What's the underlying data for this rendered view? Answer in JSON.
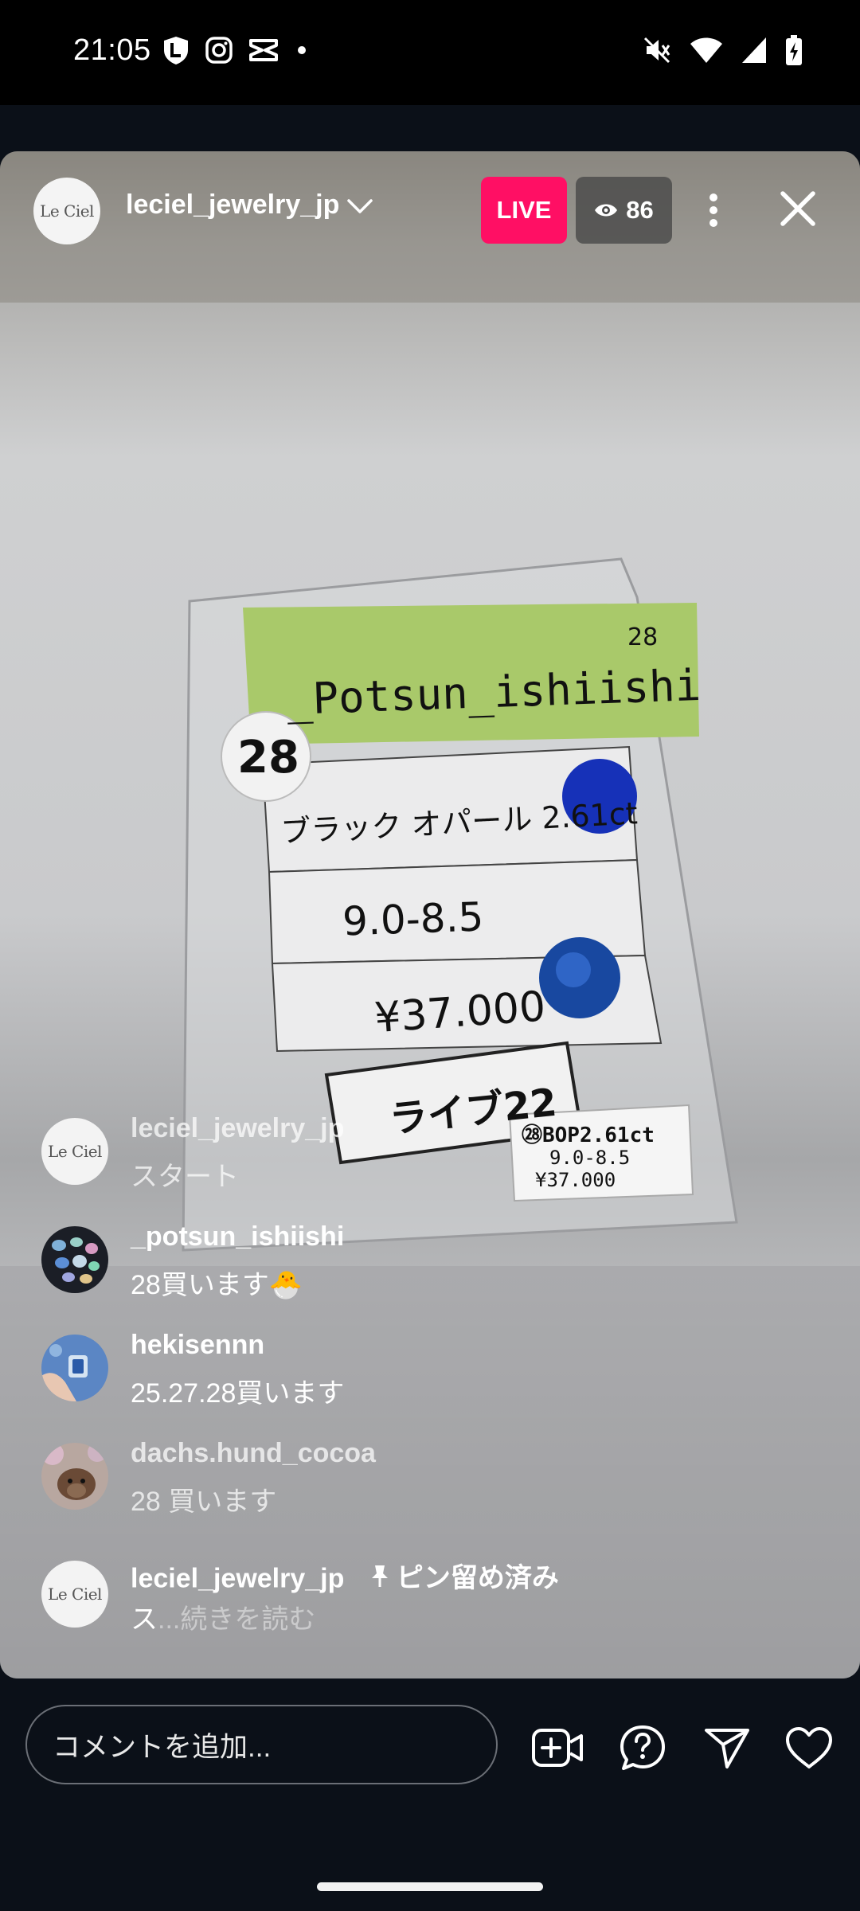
{
  "status_bar": {
    "time": "21:05",
    "left_icons": [
      "lock-l-icon",
      "instagram-icon",
      "capcut-icon",
      "dot-icon"
    ],
    "right_icons": [
      "mute-icon",
      "wifi-icon",
      "signal-icon",
      "battery-charging-icon"
    ]
  },
  "live": {
    "host": {
      "username": "leciel_jewelry_jp",
      "avatar_logo": "Le Ciel"
    },
    "badge": "LIVE",
    "viewers": "86"
  },
  "comments": [
    {
      "username": "leciel_jewelry_jp",
      "text": "スタート",
      "avatar": "logo",
      "faded": true
    },
    {
      "username": "_potsun_ishiishi",
      "text": "28買います🐣",
      "avatar": "stones",
      "faded": false
    },
    {
      "username": "hekisennn",
      "text": "25.27.28買います",
      "avatar": "hand",
      "faded": false
    },
    {
      "username": "dachs.hund_cocoa",
      "text": "28 買います",
      "avatar": "dog",
      "faded": true
    }
  ],
  "pinned_comment": {
    "username": "leciel_jewelry_jp",
    "pin_label": "ピン留め済み",
    "text": "ス",
    "read_more": "...続きを読む",
    "avatar_logo": "Le Ciel"
  },
  "bottom_bar": {
    "comment_placeholder": "コメントを追加...",
    "icons": [
      "add-video-guest-icon",
      "question-icon",
      "send-icon",
      "heart-icon"
    ]
  }
}
